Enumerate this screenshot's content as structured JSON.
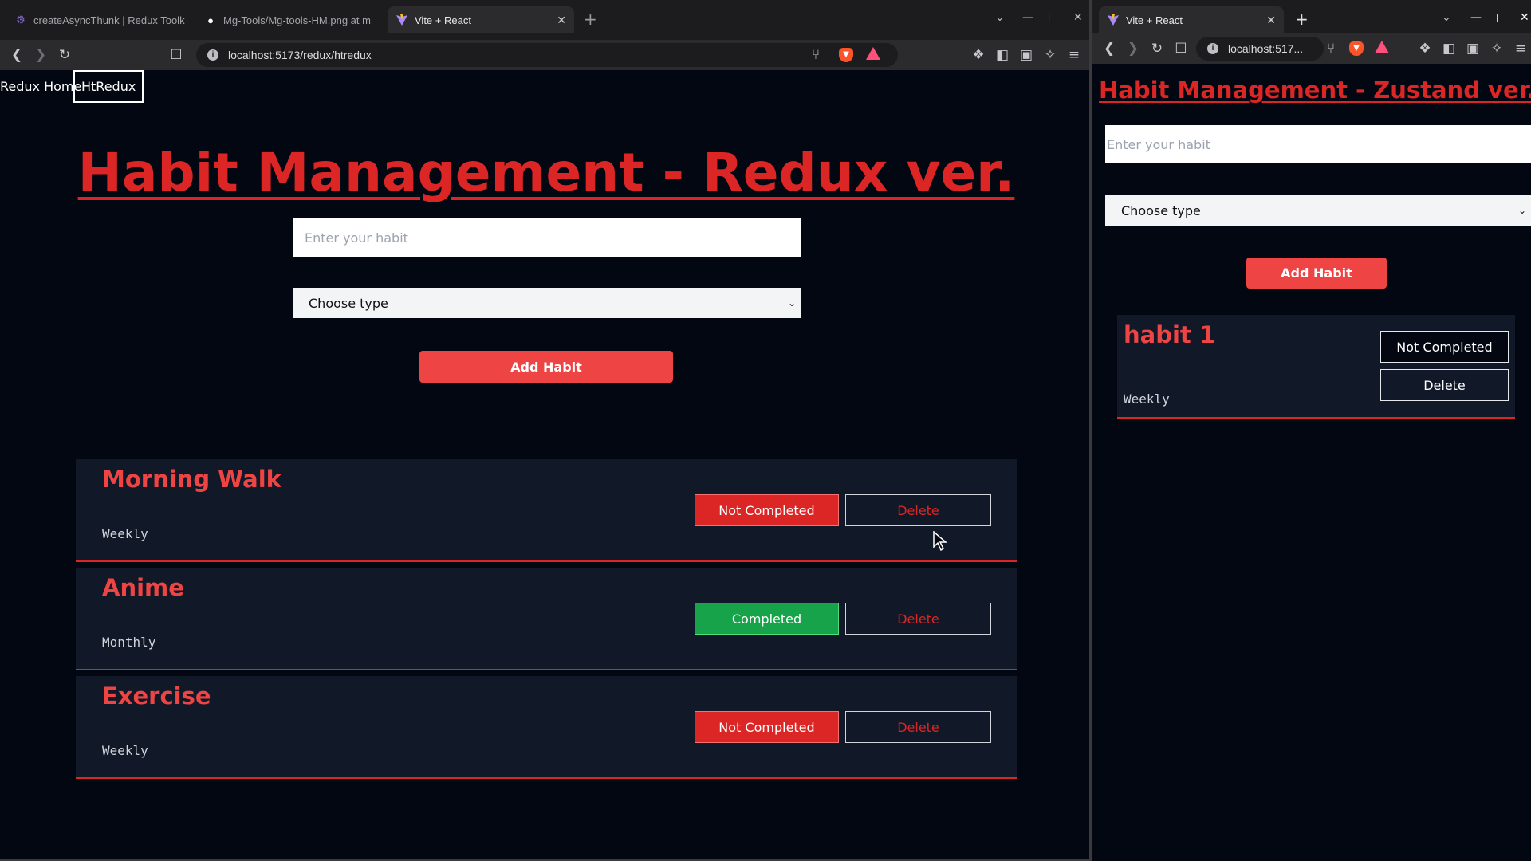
{
  "left_window": {
    "tabs": [
      {
        "title": "createAsyncThunk | Redux Toolk",
        "icon": "redux-icon"
      },
      {
        "title": "Mg-Tools/Mg-tools-HM.png at m",
        "icon": "github-icon"
      },
      {
        "title": "Vite + React",
        "icon": "vite-icon",
        "active": true
      }
    ],
    "url": "localhost:5173/redux/htredux",
    "nav": {
      "home": "Redux Home",
      "current": "HtRedux"
    },
    "page": {
      "title": "Habit Management - Redux ver.",
      "input_placeholder": "Enter your habit",
      "select_value": "Choose type",
      "add_button": "Add Habit",
      "habits": [
        {
          "name": "Morning Walk",
          "type": "Weekly",
          "status": "Not Completed",
          "delete": "Delete"
        },
        {
          "name": "Anime",
          "type": "Monthly",
          "status": "Completed",
          "delete": "Delete"
        },
        {
          "name": "Exercise",
          "type": "Weekly",
          "status": "Not Completed",
          "delete": "Delete"
        }
      ]
    }
  },
  "right_window": {
    "tabs": [
      {
        "title": "Vite + React",
        "icon": "vite-icon",
        "active": true
      }
    ],
    "url": "localhost:517...",
    "page": {
      "title": "Habit Management - Zustand ver.",
      "input_placeholder": "Enter your habit",
      "select_value": "Choose type",
      "add_button": "Add Habit",
      "habits": [
        {
          "name": "habit 1",
          "type": "Weekly",
          "status": "Not Completed",
          "delete": "Delete"
        }
      ]
    }
  },
  "colors": {
    "background": "#030712",
    "accent_red": "#dc2626",
    "button_red": "#ef4444",
    "completed_green": "#16a34a",
    "card_bg": "#111827"
  }
}
